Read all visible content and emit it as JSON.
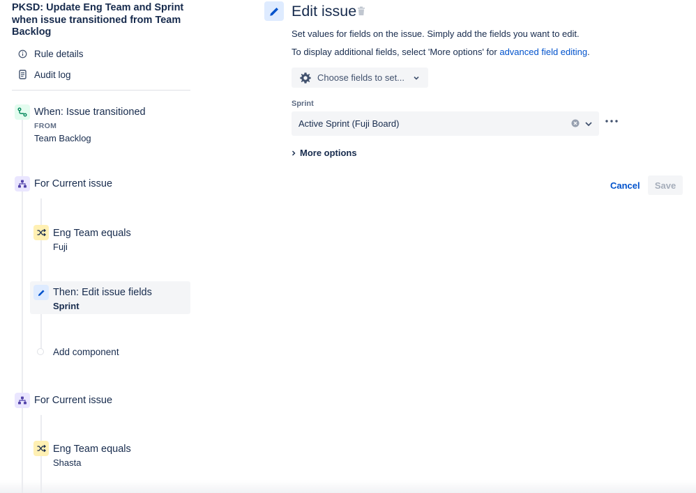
{
  "rule": {
    "title": "PKSD: Update Eng Team and Sprint when issue transitioned from Team Backlog"
  },
  "sidebar": {
    "links": [
      {
        "label": "Rule details",
        "icon": "info-icon"
      },
      {
        "label": "Audit log",
        "icon": "document-icon"
      }
    ]
  },
  "flow": {
    "trigger": {
      "title": "When: Issue transitioned",
      "small_label": "FROM",
      "value": "Team Backlog",
      "icon": "branch-icon"
    },
    "branch1": {
      "title": "For Current issue",
      "icon": "hierarchy-icon"
    },
    "condition1": {
      "title": "Eng Team equals",
      "value": "Fuji",
      "icon": "shuffle-icon"
    },
    "action1": {
      "title": "Then: Edit issue fields",
      "value": "Sprint",
      "icon": "pencil-icon"
    },
    "add_component": "Add component",
    "branch2": {
      "title": "For Current issue",
      "icon": "hierarchy-icon"
    },
    "condition2": {
      "title": "Eng Team equals",
      "value": "Shasta",
      "icon": "shuffle-icon"
    }
  },
  "editor": {
    "title": "Edit issue",
    "desc1": "Set values for fields on the issue. Simply add the fields you want to edit.",
    "desc2_prefix": "To display additional fields, select 'More options' for ",
    "desc2_link": "advanced field editing",
    "desc2_suffix": ".",
    "choose_fields": "Choose fields to set...",
    "sprint_label": "Sprint",
    "sprint_value": "Active Sprint (Fuji Board)",
    "more_options": "More options",
    "cancel": "Cancel",
    "save": "Save"
  },
  "colors": {
    "trigger_bg": "#e3fcef",
    "trigger_fg": "#00875a",
    "branch_bg": "#eae6ff",
    "branch_fg": "#5243aa",
    "condition_bg": "#fff0b3",
    "condition_fg": "#172b4d",
    "action_bg": "#deebff",
    "action_fg": "#0052cc",
    "link": "#0052cc"
  }
}
